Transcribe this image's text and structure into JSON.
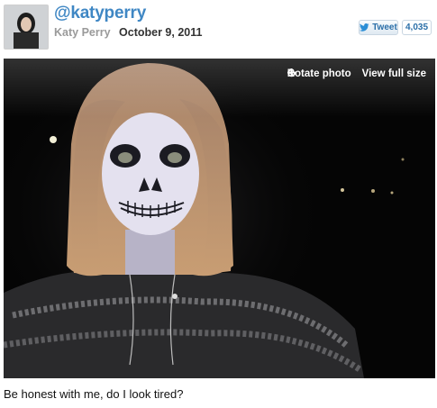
{
  "header": {
    "handle": "@katyperry",
    "display_name": "Katy Perry",
    "date": "October 9, 2011"
  },
  "actions": {
    "tweet_label": "Tweet",
    "tweet_count": "4,035",
    "rotate_label": "Rotate photo",
    "view_full_label": "View full size"
  },
  "caption": "Be honest with me, do I look tired?",
  "icons": {
    "avatar": "profile-avatar",
    "tweet": "twitter-bird-icon",
    "rotate": "rotate-icon",
    "view": "plus-icon"
  },
  "colors": {
    "handle": "#3f87c4",
    "photo_background": "#050505"
  }
}
